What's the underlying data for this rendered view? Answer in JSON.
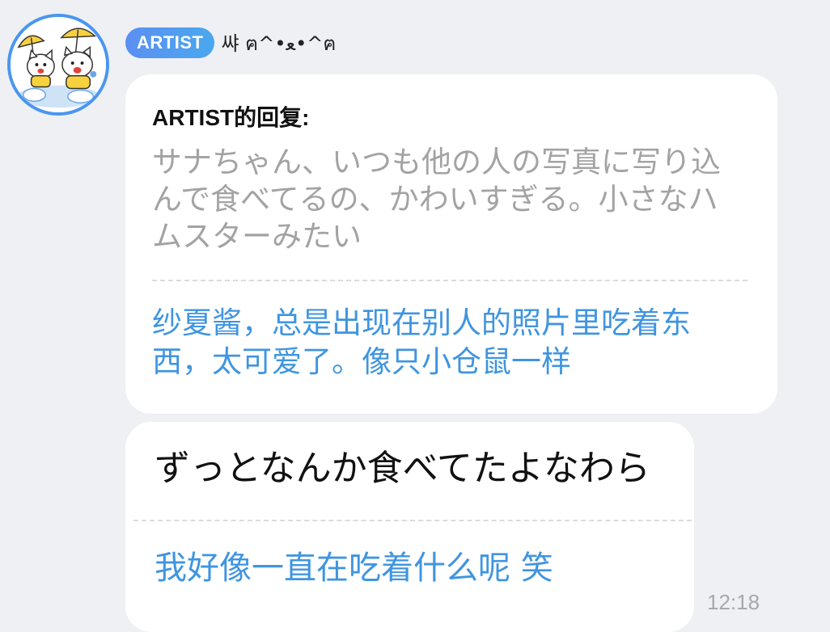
{
  "header": {
    "badge_label": "ARTIST",
    "username": "쌰 ฅ^•ﻌ•^ฅ"
  },
  "reply": {
    "title": "ARTIST的回复:",
    "quoted_text": "サナちゃん、いつも他の人の写真に写り込んで食べてるの、かわいすぎる。小さなハムスターみたい",
    "translation": "纱夏酱，总是出现在别人的照片里吃着东西，太可爱了。像只小仓鼠一样"
  },
  "message": {
    "text": "ずっとなんか食べてたよなわら",
    "translation": "我好像一直在吃着什么呢 笑",
    "time": "12:18"
  },
  "colors": {
    "accent_blue": "#3f95e0",
    "badge_gradient_start": "#5b8ff2",
    "badge_gradient_end": "#4aa8ee",
    "background": "#eef0f4",
    "quote_gray": "#a3a3a3"
  }
}
